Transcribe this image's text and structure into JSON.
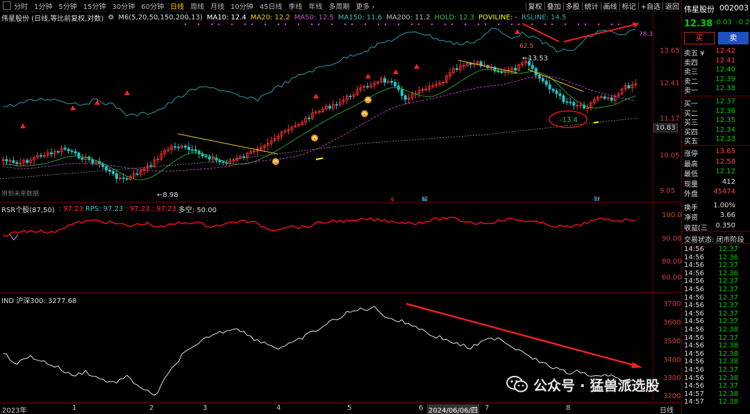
{
  "toolbar": {
    "periods": [
      "分时",
      "1分钟",
      "5分钟",
      "15分钟",
      "30分钟",
      "60分钟",
      "日线",
      "周线",
      "月线",
      "10分钟",
      "45日线",
      "季线",
      "年线",
      "多周期",
      "更多 ›"
    ],
    "active_period": "日线",
    "right_items": [
      "复权",
      "叠加",
      "多股",
      "统计",
      "画线",
      "标记",
      "+自选",
      "返回"
    ]
  },
  "main_info": {
    "title": "伟星股份 (日线,等比前复权,对数)",
    "m6": "M6(5,20,50,150,200,13)",
    "ma10": "MA10: 12.4",
    "ma20": "MA20: 12.2",
    "ma50": "MA50: 12.5",
    "ma150": "MA150: 11.6",
    "ma200": "MA200: 11.2",
    "hold": "HOLD: 12.3",
    "poviline": "POVILINE: -",
    "rsline": "RSLINE: 14.5"
  },
  "main_annotations": {
    "low_label": "←8.98",
    "high_label": "←13.53",
    "peak_label": "62.5",
    "circle_label": "-13.4",
    "rs_label": "78.3",
    "future_text": "用到未来数据",
    "marker_s": "§",
    "marker_jie": "解",
    "marker_cai": "财"
  },
  "main_yaxis": [
    "13.65",
    "12.41",
    "11.17",
    "10.83",
    "10.05",
    "9.05"
  ],
  "rsr_info": {
    "title": "RSR个股(87,50)",
    "v1": ": 97.23",
    "rps": "RPS: 97.23",
    "v2": ": 97.23",
    "v3": ": 97.23",
    "duokong": "多空: 50.00"
  },
  "rsr_yaxis": [
    "100.0",
    "90.00",
    "80.00",
    "70.00",
    "60.00"
  ],
  "ind_info": {
    "title": "IND 沪深300: 3277.68"
  },
  "ind_yaxis": [
    "3700",
    "3600",
    "3500",
    "3400",
    "3300",
    "3200"
  ],
  "xaxis": {
    "labels": [
      "2023年",
      "1",
      "2",
      "3",
      "4",
      "5",
      "6",
      "2024/06/06/四",
      "7",
      "8"
    ],
    "end_label": "日线"
  },
  "sidebar": {
    "stock_name": "伟星股份",
    "stock_code": "002003",
    "price": "12.38",
    "change": "-0.03",
    "pct": "-0.24",
    "buy_button": "买",
    "sell_button": "卖",
    "asks": [
      {
        "label": "卖五 ¥",
        "price": "12.42"
      },
      {
        "label": "卖四",
        "price": "12.41"
      },
      {
        "label": "卖三",
        "price": "12.40"
      },
      {
        "label": "卖二",
        "price": "12.39"
      },
      {
        "label": "卖一",
        "price": "12.38"
      }
    ],
    "bids": [
      {
        "label": "买一",
        "price": "12.37"
      },
      {
        "label": "买二",
        "price": "12.36"
      },
      {
        "label": "买三",
        "price": "12.35"
      },
      {
        "label": "买四",
        "price": "12.34"
      },
      {
        "label": "买五",
        "price": "12.33"
      }
    ],
    "stats": [
      {
        "label": "涨停",
        "value": "13.65"
      },
      {
        "label": "最高",
        "value": "12.58"
      },
      {
        "label": "最低",
        "value": "12.12"
      },
      {
        "label": "现量",
        "value": "412"
      },
      {
        "label": "外盘",
        "value": "45474"
      },
      {
        "label": "换手",
        "value": "1.00%"
      },
      {
        "label": "净资",
        "value": "3.66"
      },
      {
        "label": "收益(三",
        "value": "0.350"
      }
    ],
    "trade_status": "交易状态: 闭市阶段",
    "ticks": [
      {
        "time": "14:56",
        "price": "12.37"
      },
      {
        "time": "14:56",
        "price": "12.36"
      },
      {
        "time": "14:56",
        "price": "12.37"
      },
      {
        "time": "14:56",
        "price": "12.36"
      },
      {
        "time": "14:56",
        "price": "12.37"
      },
      {
        "time": "14:56",
        "price": "12.37"
      },
      {
        "time": "14:56",
        "price": "12.37"
      },
      {
        "time": "14:56",
        "price": "12.37"
      },
      {
        "time": "14:56",
        "price": "12.37"
      },
      {
        "time": "14:56",
        "price": "12.37"
      },
      {
        "time": "14:56",
        "price": "12.38"
      },
      {
        "time": "14:56",
        "price": "12.37"
      },
      {
        "time": "14:56",
        "price": "12.38"
      },
      {
        "time": "14:56",
        "price": "12.38"
      },
      {
        "time": "14:56",
        "price": "12.38"
      },
      {
        "time": "14:56",
        "price": "12.37"
      },
      {
        "time": "14:56",
        "price": "12.38"
      },
      {
        "time": "14:56",
        "price": "12.37"
      },
      {
        "time": "14:57",
        "price": "12.38"
      },
      {
        "time": "14:57",
        "price": "12.38"
      }
    ]
  },
  "watermark": {
    "text": "公众号 · 猛兽派选股"
  },
  "colors": {
    "up": "#ff3333",
    "down": "#20c8c8",
    "ma_green": "#2aa02a",
    "ma_purple": "#c040c0",
    "rs_line": "#2aa0a8",
    "rsr_line": "#ee1111",
    "ind_line": "#e8e8e8",
    "arrow": "#ee2222",
    "trend_yellow": "#e0d020"
  }
}
